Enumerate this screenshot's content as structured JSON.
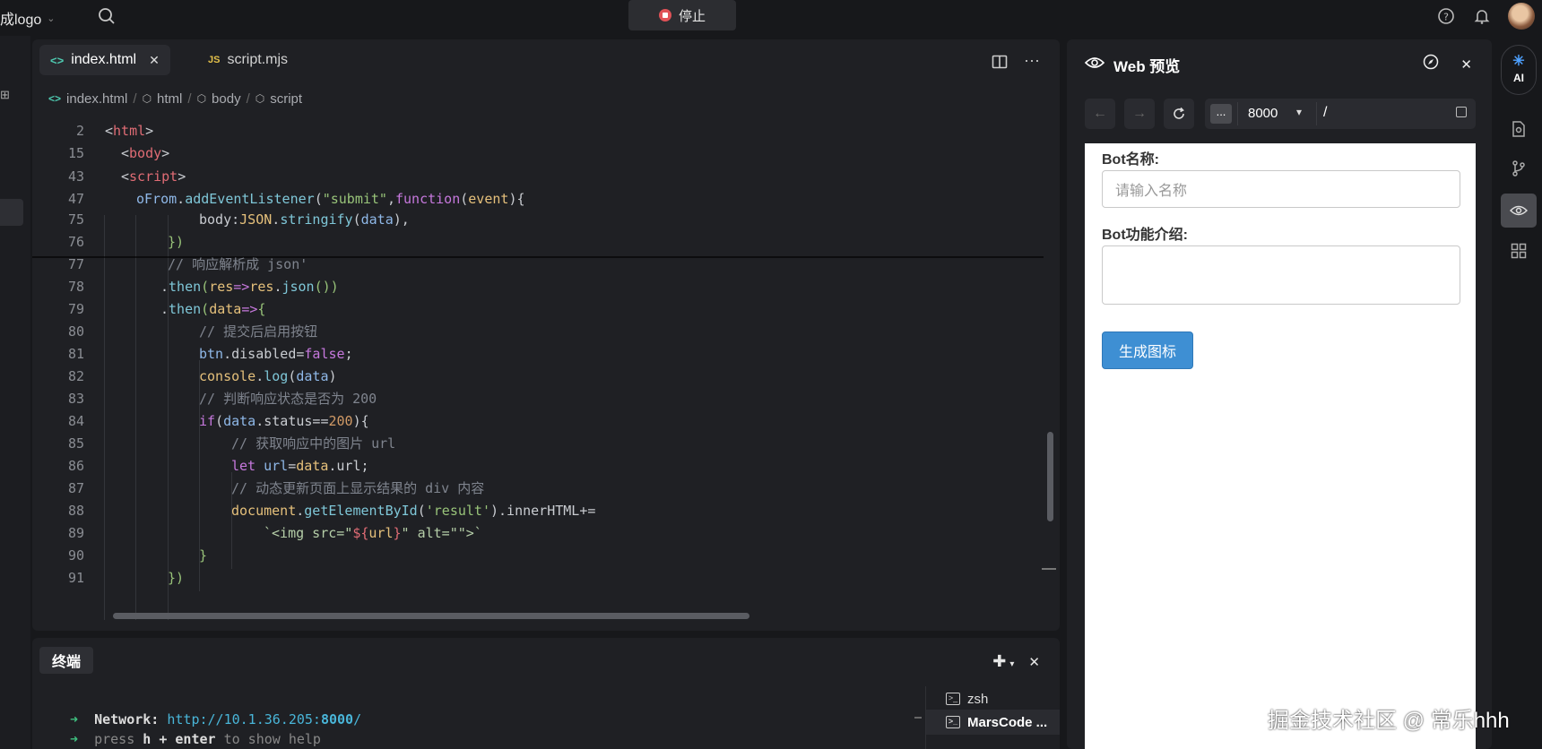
{
  "topbar": {
    "logo_text": "成logo",
    "stop_label": "停止"
  },
  "editor": {
    "tabs": [
      {
        "label": "index.html",
        "active": true
      },
      {
        "label": "script.mjs",
        "badge": "JS"
      }
    ],
    "breadcrumb": [
      "index.html",
      "html",
      "body",
      "script"
    ],
    "line_numbers": [
      "2",
      "15",
      "43",
      "47",
      "75",
      "76",
      "77",
      "78",
      "79",
      "80",
      "81",
      "82",
      "83",
      "84",
      "85",
      "86",
      "87",
      "88",
      "89",
      "90",
      "91"
    ]
  },
  "terminal": {
    "tab_label": "终端",
    "network_label": "Network:",
    "network_url": "http://10.1.36.205:",
    "network_port": "8000",
    "network_slash": "/",
    "help_line_1": "press ",
    "help_key": "h + enter",
    "help_line_2": " to show help",
    "sessions": [
      "zsh",
      "MarsCode ..."
    ]
  },
  "preview": {
    "title": "Web 预览",
    "url_dots": "...",
    "port": "8000",
    "path": "/",
    "form": {
      "name_label": "Bot名称:",
      "name_placeholder": "请输入名称",
      "desc_label": "Bot功能介绍:",
      "submit_label": "生成图标"
    }
  },
  "rightrail": {
    "ai_label": "AI"
  },
  "watermark": "掘金技术社区 @ 常乐hhh",
  "colors": {
    "accent": "#3e8fd3",
    "stop": "#e05257",
    "bg": "#17181b"
  }
}
